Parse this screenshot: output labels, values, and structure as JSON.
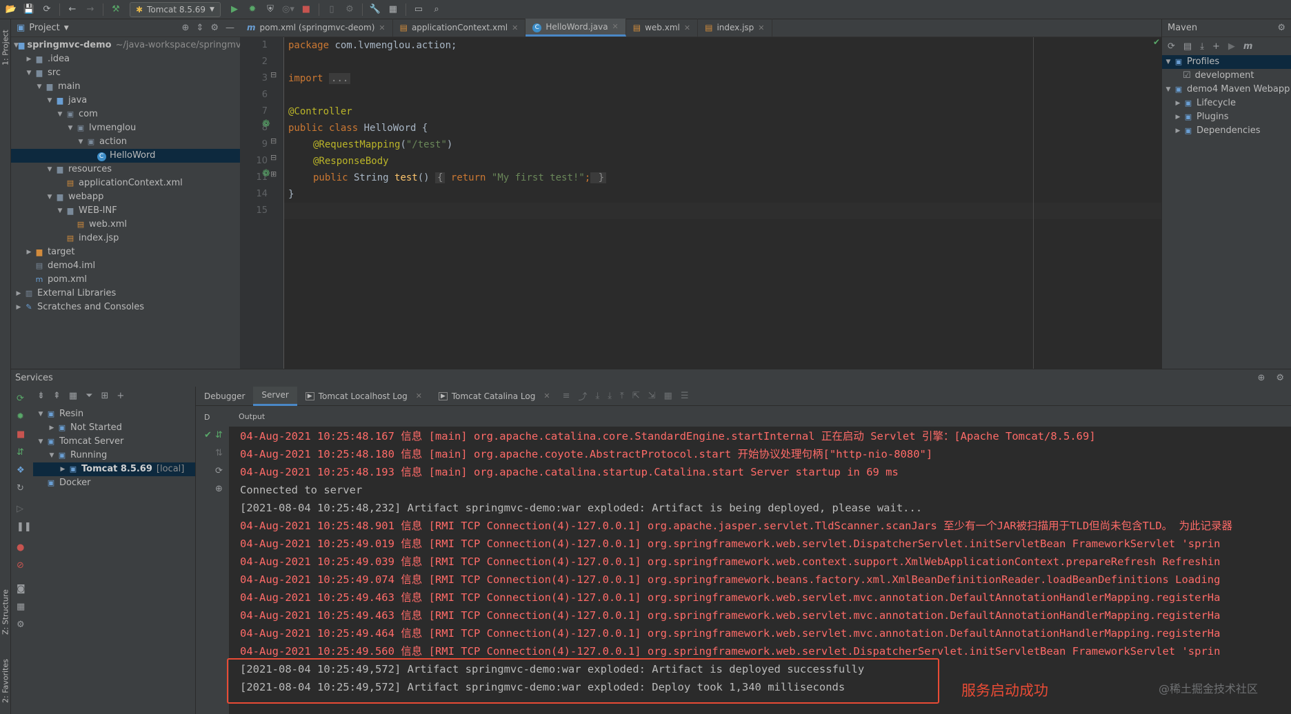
{
  "toolbar": {
    "run_config": "Tomcat 8.5.69"
  },
  "left_strip": {
    "project_label": "1: Project",
    "structure_label": "Z: Structure",
    "favorites_label": "2: Favorites"
  },
  "project": {
    "header": "Project",
    "tree": [
      {
        "label": "springmvc-demo",
        "path": "~/java-workspace/springmvc",
        "depth": 0,
        "arrow": "down",
        "icon": "module-folder",
        "bold": true
      },
      {
        "label": ".idea",
        "depth": 1,
        "arrow": "right",
        "icon": "folder"
      },
      {
        "label": "src",
        "depth": 1,
        "arrow": "down",
        "icon": "folder"
      },
      {
        "label": "main",
        "depth": 2,
        "arrow": "down",
        "icon": "folder"
      },
      {
        "label": "java",
        "depth": 3,
        "arrow": "down",
        "icon": "source-folder"
      },
      {
        "label": "com",
        "depth": 4,
        "arrow": "down",
        "icon": "package"
      },
      {
        "label": "lvmenglou",
        "depth": 5,
        "arrow": "down",
        "icon": "package"
      },
      {
        "label": "action",
        "depth": 6,
        "arrow": "down",
        "icon": "package"
      },
      {
        "label": "HelloWord",
        "depth": 7,
        "arrow": "",
        "icon": "class",
        "selected": true
      },
      {
        "label": "resources",
        "depth": 3,
        "arrow": "down",
        "icon": "resources-folder"
      },
      {
        "label": "applicationContext.xml",
        "depth": 4,
        "arrow": "",
        "icon": "xml"
      },
      {
        "label": "webapp",
        "depth": 3,
        "arrow": "down",
        "icon": "web-folder"
      },
      {
        "label": "WEB-INF",
        "depth": 4,
        "arrow": "down",
        "icon": "folder"
      },
      {
        "label": "web.xml",
        "depth": 5,
        "arrow": "",
        "icon": "xml"
      },
      {
        "label": "index.jsp",
        "depth": 4,
        "arrow": "",
        "icon": "jsp"
      },
      {
        "label": "target",
        "depth": 1,
        "arrow": "right",
        "icon": "excluded-folder"
      },
      {
        "label": "demo4.iml",
        "depth": 1,
        "arrow": "",
        "icon": "iml"
      },
      {
        "label": "pom.xml",
        "depth": 1,
        "arrow": "",
        "icon": "maven"
      },
      {
        "label": "External Libraries",
        "depth": 0,
        "arrow": "right",
        "icon": "libraries"
      },
      {
        "label": "Scratches and Consoles",
        "depth": 0,
        "arrow": "right",
        "icon": "scratches"
      }
    ]
  },
  "editor": {
    "tabs": [
      {
        "label": "pom.xml (springmvc-deom)",
        "icon": "m",
        "active": false
      },
      {
        "label": "applicationContext.xml",
        "icon": "xml",
        "active": false
      },
      {
        "label": "HelloWord.java",
        "icon": "class",
        "active": true
      },
      {
        "label": "web.xml",
        "icon": "xml",
        "active": false
      },
      {
        "label": "index.jsp",
        "icon": "jsp",
        "active": false
      }
    ],
    "line_numbers": [
      "1",
      "2",
      "3",
      "6",
      "7",
      "8",
      "9",
      "10",
      "11",
      "14",
      "15"
    ],
    "code": {
      "l1_kw": "package",
      "l1_rest": " com.lvmenglou.action;",
      "l3_kw": "import",
      "l3_fold": "...",
      "l7_an": "@Controller",
      "l8_kw": "public class",
      "l8_rest": " HelloWord {",
      "l9_an": "@RequestMapping",
      "l9_open": "(",
      "l9_str": "\"/test\"",
      "l9_close": ")",
      "l10_an": "@ResponseBody",
      "l11_kw": "public",
      "l11_type": " String ",
      "l11_fn": "test",
      "l11_paren": "() ",
      "l11_b1": "{",
      "l11_ret": " return ",
      "l11_str": "\"My first test!\"",
      "l11_semi": ";",
      "l11_b2": " }",
      "l14": "}"
    }
  },
  "maven": {
    "header": "Maven",
    "tree": [
      {
        "label": "Profiles",
        "depth": 0,
        "arrow": "down",
        "selected": true
      },
      {
        "label": "development",
        "depth": 1,
        "arrow": "",
        "checkbox": true
      },
      {
        "label": "demo4 Maven Webapp",
        "depth": 0,
        "arrow": "down"
      },
      {
        "label": "Lifecycle",
        "depth": 1,
        "arrow": "right"
      },
      {
        "label": "Plugins",
        "depth": 1,
        "arrow": "right"
      },
      {
        "label": "Dependencies",
        "depth": 1,
        "arrow": "right"
      }
    ]
  },
  "services": {
    "header": "Services",
    "tree": [
      {
        "label": "Resin",
        "depth": 0,
        "arrow": "down"
      },
      {
        "label": "Not Started",
        "depth": 1,
        "arrow": "right"
      },
      {
        "label": "Tomcat Server",
        "depth": 0,
        "arrow": "down"
      },
      {
        "label": "Running",
        "depth": 1,
        "arrow": "down"
      },
      {
        "label": "Tomcat 8.5.69",
        "suffix": "[local]",
        "depth": 2,
        "arrow": "right",
        "selected": true
      },
      {
        "label": "Docker",
        "depth": 0,
        "arrow": ""
      }
    ],
    "tabs": [
      {
        "label": "Debugger",
        "active": false
      },
      {
        "label": "Server",
        "active": true
      },
      {
        "label": "Tomcat Localhost Log",
        "active": false,
        "closable": true
      },
      {
        "label": "Tomcat Catalina Log",
        "active": false,
        "closable": true
      }
    ],
    "deploy_col_label": "D",
    "output_label": "Output"
  },
  "console": {
    "lines": [
      {
        "text": "04-Aug-2021 10:25:48.167 信息 [main] org.apache.catalina.core.StandardEngine.startInternal 正在启动 Servlet 引擎：[Apache Tomcat/8.5.69]",
        "kind": "err"
      },
      {
        "text": "04-Aug-2021 10:25:48.180 信息 [main] org.apache.coyote.AbstractProtocol.start 开始协议处理句柄[\"http-nio-8080\"]",
        "kind": "err"
      },
      {
        "text": "04-Aug-2021 10:25:48.193 信息 [main] org.apache.catalina.startup.Catalina.start Server startup in 69 ms",
        "kind": "err"
      },
      {
        "text": "Connected to server",
        "kind": "info"
      },
      {
        "text": "[2021-08-04 10:25:48,232] Artifact springmvc-demo:war exploded: Artifact is being deployed, please wait...",
        "kind": "info"
      },
      {
        "text": "04-Aug-2021 10:25:48.901 信息 [RMI TCP Connection(4)-127.0.0.1] org.apache.jasper.servlet.TldScanner.scanJars 至少有一个JAR被扫描用于TLD但尚未包含TLD。 为此记录器",
        "kind": "err"
      },
      {
        "text": "04-Aug-2021 10:25:49.019 信息 [RMI TCP Connection(4)-127.0.0.1] org.springframework.web.servlet.DispatcherServlet.initServletBean FrameworkServlet 'sprin",
        "kind": "err"
      },
      {
        "text": "04-Aug-2021 10:25:49.039 信息 [RMI TCP Connection(4)-127.0.0.1] org.springframework.web.context.support.XmlWebApplicationContext.prepareRefresh Refreshin",
        "kind": "err"
      },
      {
        "text": "04-Aug-2021 10:25:49.074 信息 [RMI TCP Connection(4)-127.0.0.1] org.springframework.beans.factory.xml.XmlBeanDefinitionReader.loadBeanDefinitions Loading",
        "kind": "err"
      },
      {
        "text": "04-Aug-2021 10:25:49.463 信息 [RMI TCP Connection(4)-127.0.0.1] org.springframework.web.servlet.mvc.annotation.DefaultAnnotationHandlerMapping.registerHa",
        "kind": "err"
      },
      {
        "text": "04-Aug-2021 10:25:49.463 信息 [RMI TCP Connection(4)-127.0.0.1] org.springframework.web.servlet.mvc.annotation.DefaultAnnotationHandlerMapping.registerHa",
        "kind": "err"
      },
      {
        "text": "04-Aug-2021 10:25:49.464 信息 [RMI TCP Connection(4)-127.0.0.1] org.springframework.web.servlet.mvc.annotation.DefaultAnnotationHandlerMapping.registerHa",
        "kind": "err"
      },
      {
        "text": "04-Aug-2021 10:25:49.560 信息 [RMI TCP Connection(4)-127.0.0.1] org.springframework.web.servlet.DispatcherServlet.initServletBean FrameworkServlet 'sprin",
        "kind": "err"
      },
      {
        "text": "[2021-08-04 10:25:49,572] Artifact springmvc-demo:war exploded: Artifact is deployed successfully",
        "kind": "info"
      },
      {
        "text": "[2021-08-04 10:25:49,572] Artifact springmvc-demo:war exploded: Deploy took 1,340 milliseconds",
        "kind": "info"
      }
    ]
  },
  "annotation": {
    "label": "服务启动成功",
    "color": "#e94b35"
  },
  "watermark": "@稀土掘金技术社区",
  "colors": {
    "keyword": "#cc7832",
    "annotation": "#bbb529",
    "string": "#6a8759",
    "error_text": "#ff6b68",
    "accent": "#4a88c7"
  }
}
